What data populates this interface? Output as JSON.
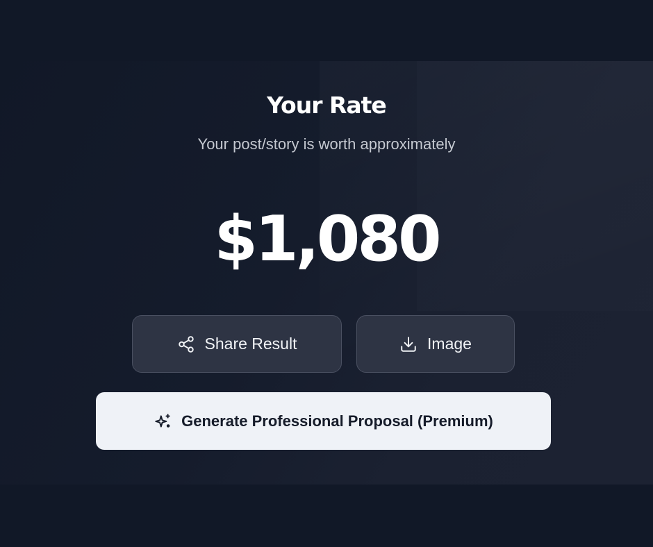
{
  "result": {
    "title": "Your Rate",
    "subtitle": "Your post/story is worth approximately",
    "amount": "$1,080"
  },
  "actions": {
    "share_label": "Share Result",
    "share_icon": "share-icon",
    "image_label": "Image",
    "image_icon": "download-icon",
    "proposal_label": "Generate Professional Proposal (Premium)",
    "proposal_icon": "sparkles-icon"
  },
  "colors": {
    "background": "#111827",
    "button_secondary": "#2e3444",
    "button_primary": "#eff2f7",
    "text_primary": "#ffffff"
  }
}
